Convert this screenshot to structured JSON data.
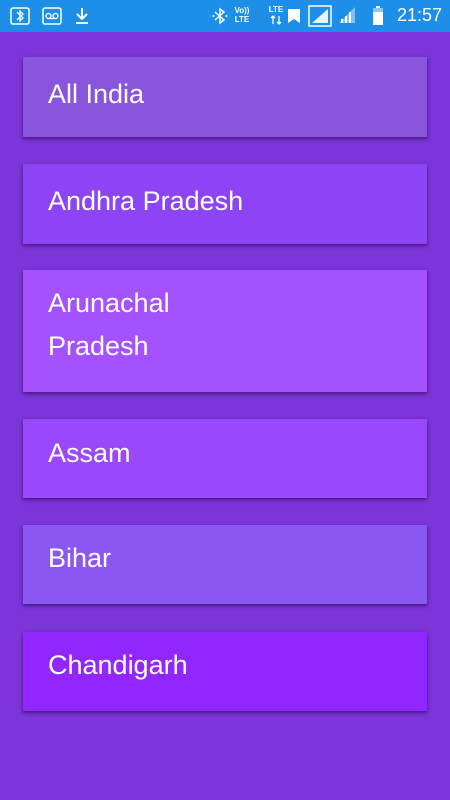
{
  "status_bar": {
    "time": "21:57",
    "volte_label": "Vo)) LTE",
    "lte_label": "LTE",
    "icons": [
      "bluetooth-icon",
      "voicemail-icon",
      "download-icon",
      "bluetooth-icon",
      "volte-icon",
      "lte-icon",
      "data-arrows-icon",
      "signal-icon",
      "signal-icon",
      "battery-icon"
    ],
    "color": "#1e8fe8"
  },
  "regions": [
    {
      "label": "All India",
      "color": "#8a55dd"
    },
    {
      "label": "Andhra Pradesh",
      "color": "#8d44f5"
    },
    {
      "label": "Arunachal Pradesh",
      "color": "#a452fe"
    },
    {
      "label": "Assam",
      "color": "#9a48fb"
    },
    {
      "label": "Bihar",
      "color": "#8b57f2"
    },
    {
      "label": "Chandigarh",
      "color": "#9127fe"
    }
  ],
  "background": "#7b35d8"
}
